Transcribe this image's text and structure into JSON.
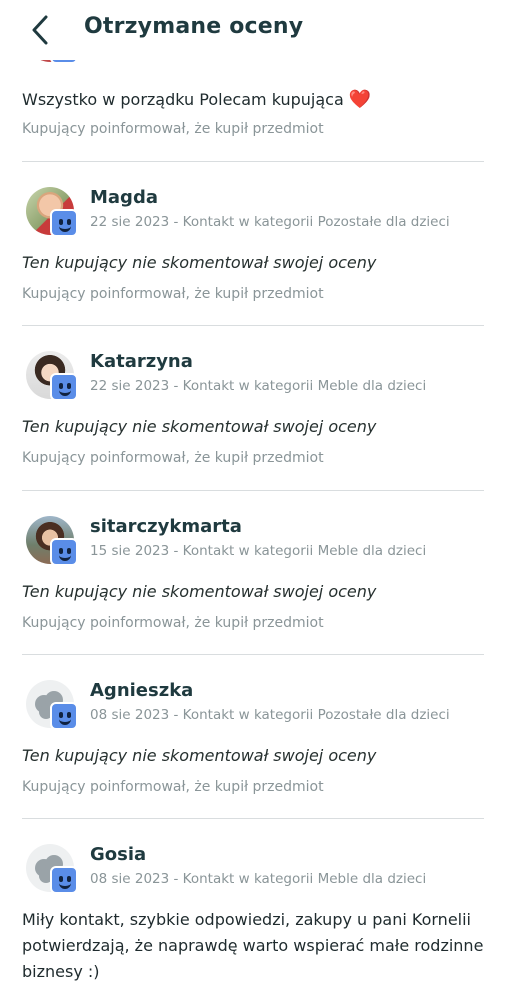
{
  "header": {
    "title": "Otrzymane oceny",
    "back_icon": "chevron-left-icon"
  },
  "first_review": {
    "comment": "Wszystko w porządku Polecam kupująca",
    "comment_emoji": "❤️",
    "note": "Kupujący poinformował, że kupił przedmiot"
  },
  "reviews": [
    {
      "name": "Magda",
      "meta": "22 sie 2023 - Kontakt w kategorii Pozostałe dla dzieci",
      "comment": "Ten kupujący nie skomentował swojej oceny",
      "note": "Kupujący poinformował, że kupił przedmiot"
    },
    {
      "name": "Katarzyna",
      "meta": "22 sie 2023 - Kontakt w kategorii Meble dla dzieci",
      "comment": "Ten kupujący nie skomentował swojej oceny",
      "note": "Kupujący poinformował, że kupił przedmiot"
    },
    {
      "name": "sitarczykmarta",
      "meta": "15 sie 2023 - Kontakt w kategorii Meble dla dzieci",
      "comment": "Ten kupujący nie skomentował swojej oceny",
      "note": "Kupujący poinformował, że kupił przedmiot"
    },
    {
      "name": "Agnieszka",
      "meta": "08 sie 2023 - Kontakt w kategorii Pozostałe dla dzieci",
      "comment": "Ten kupujący nie skomentował swojej oceny",
      "note": "Kupujący poinformował, że kupił przedmiot"
    },
    {
      "name": "Gosia",
      "meta": "08 sie 2023 - Kontakt w kategorii Meble dla dzieci",
      "comment": "Miły kontakt, szybkie odpowiedzi, zakupy u pani Kornelii potwierdzają, że naprawdę warto wspierać małe rodzinne biznesy :)"
    }
  ],
  "colors": {
    "title": "#1f3a3f",
    "meta": "#8a9598",
    "badge": "#5a8de8",
    "divider": "#d9dddf",
    "heart": "#d62b2b"
  }
}
